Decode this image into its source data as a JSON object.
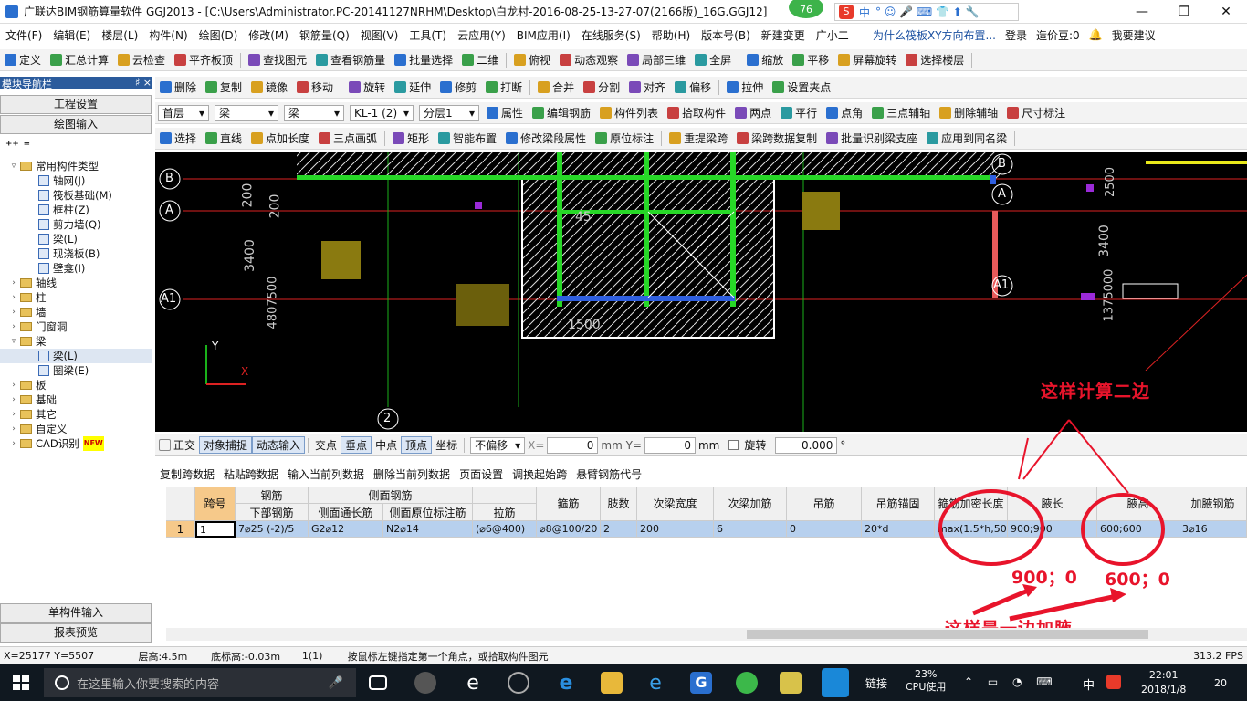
{
  "window": {
    "title": "广联达BIM钢筋算量软件 GGJ2013 - [C:\\Users\\Administrator.PC-20141127NRHM\\Desktop\\白龙村-2016-08-25-13-27-07(2166版)_16G.GGJ12]",
    "badge": "76",
    "ime_label": "中"
  },
  "menu": [
    "文件(F)",
    "编辑(E)",
    "楼层(L)",
    "构件(N)",
    "绘图(D)",
    "修改(M)",
    "钢筋量(Q)",
    "视图(V)",
    "工具(T)",
    "云应用(Y)",
    "BIM应用(I)",
    "在线服务(S)",
    "帮助(H)",
    "版本号(B)",
    "新建变更",
    "广小二"
  ],
  "menu_right": {
    "question": "为什么筏板XY方向布置...",
    "login": "登录",
    "zaojiadou": "造价豆:0",
    "suggest": "我要建议"
  },
  "toolbar1": [
    "定义",
    "汇总计算",
    "云检查",
    "平齐板顶",
    "查找图元",
    "查看钢筋量",
    "批量选择",
    "二维",
    "俯视",
    "动态观察",
    "局部三维",
    "全屏",
    "缩放",
    "平移",
    "屏幕旋转",
    "选择楼层"
  ],
  "nav_title": "模块导航栏",
  "nav_pin": "♯ ×",
  "nav_buttons": {
    "gcsz": "工程设置",
    "hthr": "绘图输入",
    "dgjsr": "单构件输入",
    "bbyl": "报表预览"
  },
  "tree": {
    "common": "常用构件类型",
    "common_items": [
      "轴网(J)",
      "筏板基础(M)",
      "框柱(Z)",
      "剪力墙(Q)",
      "梁(L)",
      "现浇板(B)",
      "壁龛(I)"
    ],
    "groups_before": [
      "轴线",
      "柱",
      "墙",
      "门窗洞"
    ],
    "beam_group": "梁",
    "beam_items": [
      "梁(L)",
      "圈梁(E)"
    ],
    "groups_after": [
      "板",
      "基础",
      "其它",
      "自定义",
      "CAD识别"
    ],
    "new_tag": "NEW"
  },
  "toolbar2": [
    "删除",
    "复制",
    "镜像",
    "移动",
    "旋转",
    "延伸",
    "修剪",
    "打断",
    "合并",
    "分割",
    "对齐",
    "偏移",
    "拉伸",
    "设置夹点"
  ],
  "toolbar3": {
    "floor": "首层",
    "type1": "梁",
    "type2": "梁",
    "name": "KL-1 (2)",
    "layer": "分层1",
    "items": [
      "属性",
      "编辑钢筋",
      "构件列表",
      "拾取构件",
      "两点",
      "平行",
      "点角",
      "三点辅轴",
      "删除辅轴",
      "尺寸标注"
    ]
  },
  "toolbar4": [
    "选择",
    "直线",
    "点加长度",
    "三点画弧",
    "矩形",
    "智能布置",
    "修改梁段属性",
    "原位标注",
    "重提梁跨",
    "梁跨数据复制",
    "批量识别梁支座",
    "应用到同名梁"
  ],
  "canvas": {
    "axes": [
      "B",
      "A",
      "A1",
      "2",
      "B",
      "A",
      "A1"
    ],
    "dims": [
      "200",
      "200",
      "3400",
      "4800",
      "3400",
      "45",
      "1500",
      "4807500",
      "2500",
      "1375000"
    ],
    "axis_x": "X",
    "axis_y": "Y"
  },
  "snap": {
    "items": [
      "正交",
      "对象捕捉",
      "动态输入",
      "交点",
      "垂点",
      "中点",
      "顶点",
      "坐标"
    ],
    "offset": "不偏移",
    "x_label": "X=",
    "x_val": "0",
    "y_label": "mm Y=",
    "y_val": "0",
    "unit": "mm",
    "rotate": "旋转",
    "rotate_val": "0.000",
    "deg": "°"
  },
  "tabletools": [
    "复制跨数据",
    "粘贴跨数据",
    "输入当前列数据",
    "删除当前列数据",
    "页面设置",
    "调换起始跨",
    "悬臂钢筋代号"
  ],
  "table": {
    "headers_top": {
      "gangjin": "钢筋",
      "cemian": "侧面钢筋"
    },
    "headers": [
      "跨号",
      "下部钢筋",
      "侧面通长筋",
      "侧面原位标注筋",
      "拉筋",
      "箍筋",
      "肢数",
      "次梁宽度",
      "次梁加筋",
      "吊筋",
      "吊筋锚固",
      "箍筋加密长度",
      "腋长",
      "腋高",
      "加腋钢筋"
    ],
    "row_index": "1",
    "row": [
      "1",
      "7⌀25 (-2)/5",
      "G2⌀12",
      "N2⌀14",
      "(⌀6@400)",
      "⌀8@100/20",
      "2",
      "200",
      "6",
      "0",
      "20*d",
      "max(1.5*h,50",
      "900;900",
      "600;600",
      "3⌀16"
    ]
  },
  "annotations": {
    "top": "这样计算二边",
    "left_val": "900；0",
    "right_val": "600；0",
    "bottom": "这样是一边加腋"
  },
  "status": {
    "coord": "X=25177 Y=5507",
    "floor_h": "层高:4.5m",
    "base_h": "底标高:-0.03m",
    "count": "1(1)",
    "hint": "按鼠标左键指定第一个角点，或拾取构件图元",
    "fps": "313.2 FPS"
  },
  "taskbar": {
    "search": "在这里输入你要搜索的内容",
    "link": "链接",
    "cpu": "23%",
    "cpu_label": "CPU使用",
    "ime": "中",
    "time": "22:01",
    "date": "2018/1/8",
    "notif": "20"
  },
  "colors": {
    "annot": "#e8142b",
    "canvas": "#000000",
    "title_bar": "#2b5b9c"
  }
}
